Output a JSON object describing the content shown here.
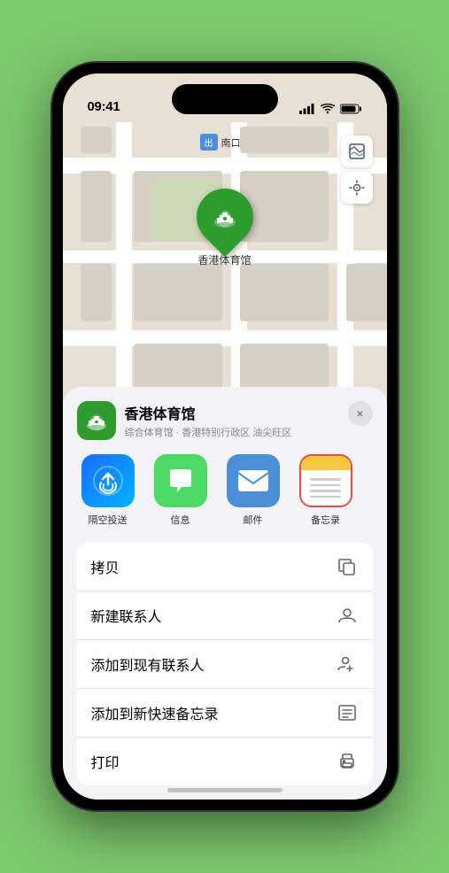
{
  "status_bar": {
    "time": "09:41",
    "location_arrow": true
  },
  "map": {
    "label_type": "南口",
    "label_type_prefix": "出"
  },
  "map_controls": {
    "map_icon": "🗺",
    "location_icon": "⬆"
  },
  "pin": {
    "label": "香港体育馆",
    "emoji": "🏟"
  },
  "venue_card": {
    "name": "香港体育馆",
    "subtitle": "综合体育馆 · 香港特别行政区 油尖旺区",
    "icon_emoji": "🏟"
  },
  "share_items": [
    {
      "id": "airdrop",
      "label": "隔空投送"
    },
    {
      "id": "message",
      "label": "信息"
    },
    {
      "id": "mail",
      "label": "邮件"
    },
    {
      "id": "notes",
      "label": "备忘录"
    }
  ],
  "actions": [
    {
      "id": "copy",
      "label": "拷贝",
      "icon": "copy"
    },
    {
      "id": "new-contact",
      "label": "新建联系人",
      "icon": "person"
    },
    {
      "id": "add-contact",
      "label": "添加到现有联系人",
      "icon": "person-add"
    },
    {
      "id": "quick-note",
      "label": "添加到新快速备忘录",
      "icon": "note"
    },
    {
      "id": "print",
      "label": "打印",
      "icon": "printer"
    }
  ],
  "close_label": "×"
}
